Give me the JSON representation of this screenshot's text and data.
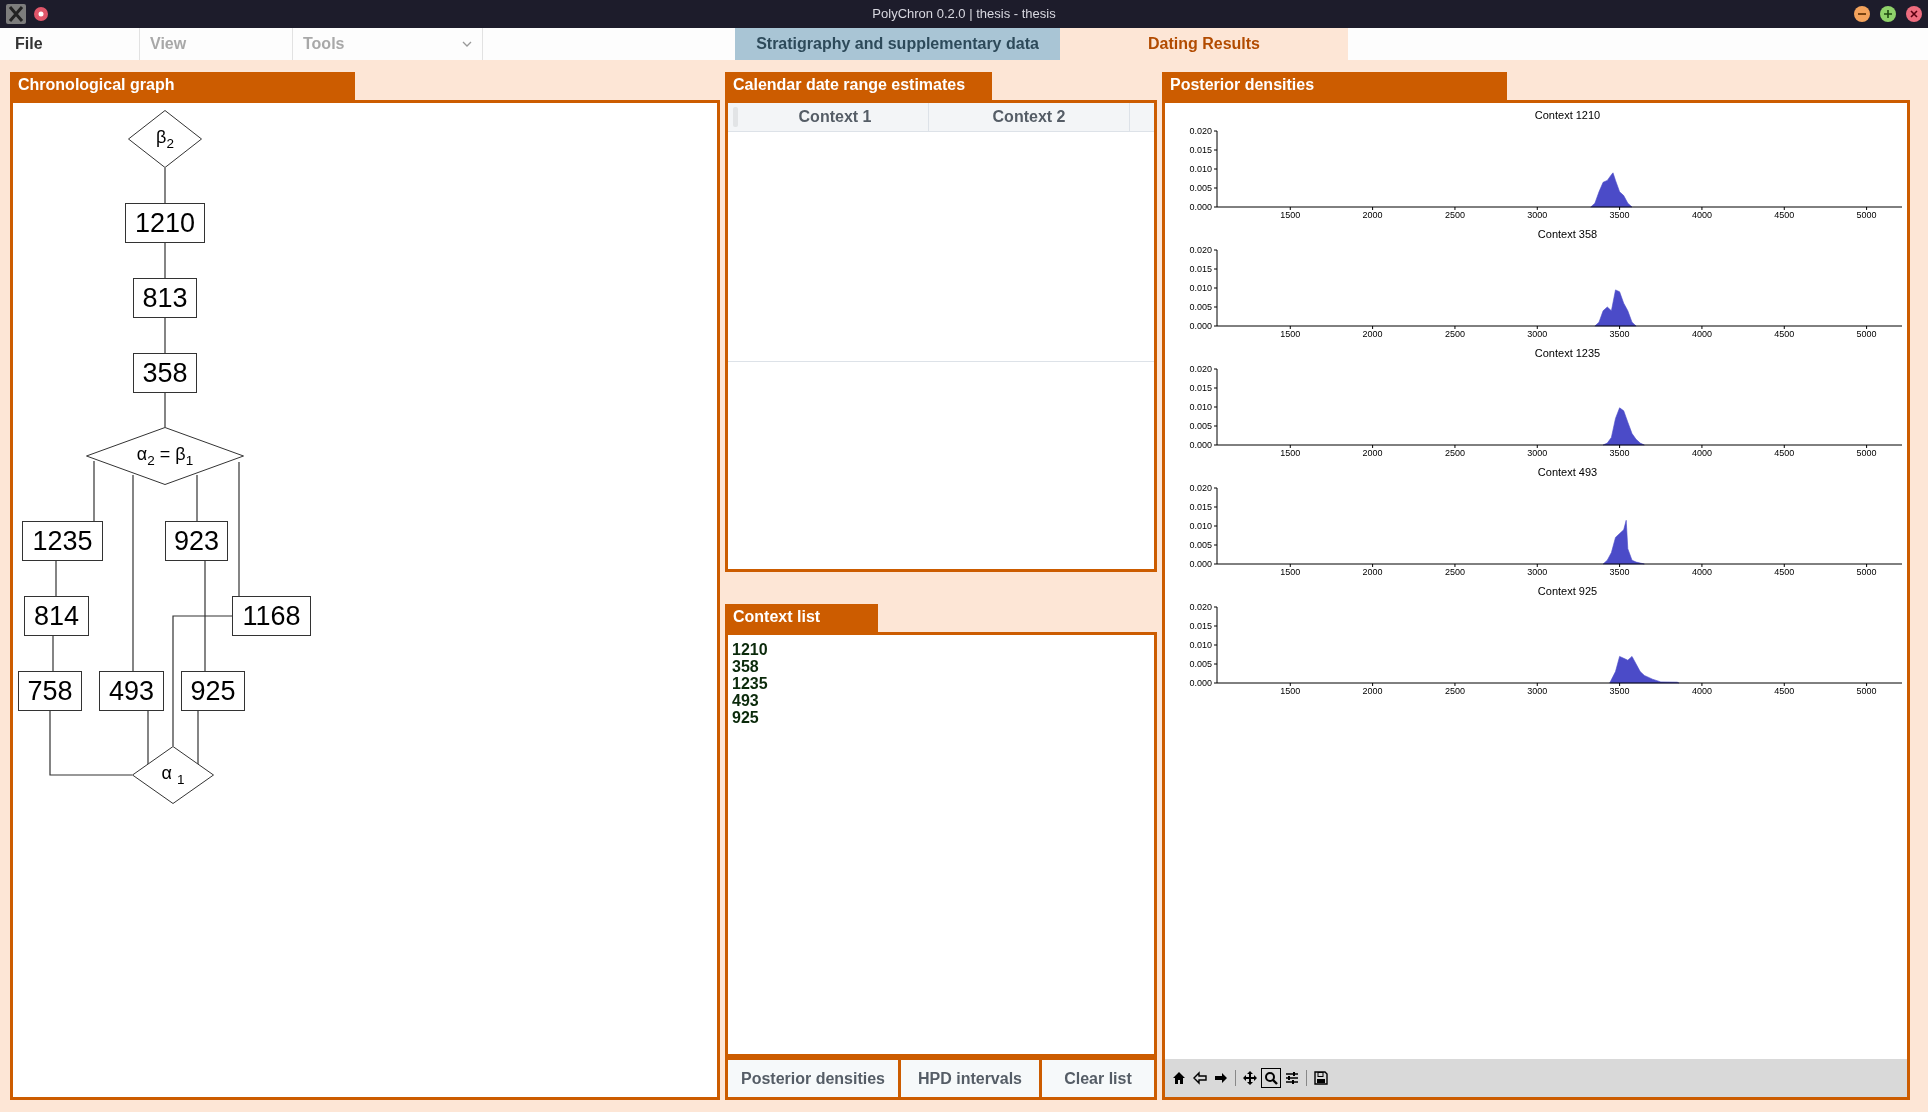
{
  "window": {
    "title": "PolyChron 0.2.0 | thesis - thesis"
  },
  "menu": [
    {
      "label": "File",
      "kind": "menu",
      "disabled": false
    },
    {
      "label": "View",
      "kind": "menu",
      "disabled": true
    },
    {
      "label": "Tools",
      "kind": "dropdown",
      "disabled": true
    }
  ],
  "tabs": [
    {
      "label": "Stratigraphy and supplementary data",
      "selected": false
    },
    {
      "label": "Dating Results",
      "selected": true
    }
  ],
  "graph_panel": {
    "title": "Chronological graph",
    "nodes": [
      {
        "label": "β$_{2}$",
        "kind": "diamond"
      },
      {
        "label": "1210",
        "kind": "box"
      },
      {
        "label": "813",
        "kind": "box"
      },
      {
        "label": "358",
        "kind": "box"
      },
      {
        "label": "α$_{2}$ = β$_{1}$",
        "kind": "diamond"
      },
      {
        "label": "1235",
        "kind": "box"
      },
      {
        "label": "923",
        "kind": "box"
      },
      {
        "label": "814",
        "kind": "box"
      },
      {
        "label": "1168",
        "kind": "box"
      },
      {
        "label": "758",
        "kind": "box"
      },
      {
        "label": "493",
        "kind": "box"
      },
      {
        "label": "925",
        "kind": "box"
      },
      {
        "label": "α $_{1}$",
        "kind": "diamond"
      }
    ]
  },
  "estimates_panel": {
    "title": "Calendar date range estimates",
    "columns": [
      "Context 1",
      "Context 2"
    ]
  },
  "context_list": {
    "title": "Context list",
    "items": [
      "1210",
      "358",
      "1235",
      "493",
      "925"
    ]
  },
  "buttons": [
    "Posterior densities",
    "HPD intervals",
    "Clear list"
  ],
  "densities_panel": {
    "title": "Posterior densities",
    "charts": [
      {
        "chart_data": {
          "type": "area",
          "title": "Context 1210",
          "x": [
            3325,
            3350,
            3375,
            3400,
            3425,
            3450,
            3460,
            3475,
            3500,
            3525,
            3550,
            3575
          ],
          "values": [
            0,
            0.001,
            0.004,
            0.0065,
            0.007,
            0.0085,
            0.009,
            0.007,
            0.004,
            0.003,
            0.001,
            0
          ],
          "xlim": [
            1055,
            5215
          ],
          "ylim": [
            0,
            0.02
          ],
          "xticks": [
            1500,
            2000,
            2500,
            3000,
            3500,
            4000,
            4500,
            5000
          ],
          "yticks": [
            {
              "value": 0,
              "label": "0.000"
            },
            {
              "value": 0.005,
              "label": "0.005"
            },
            {
              "value": 0.01,
              "label": "0.010"
            },
            {
              "value": 0.015,
              "label": "0.015"
            },
            {
              "value": 0.02,
              "label": "0.020"
            }
          ]
        }
      },
      {
        "chart_data": {
          "type": "area",
          "title": "Context 358",
          "x": [
            3350,
            3375,
            3400,
            3425,
            3450,
            3475,
            3500,
            3525,
            3550,
            3575,
            3600
          ],
          "values": [
            0,
            0.001,
            0.004,
            0.005,
            0.004,
            0.0095,
            0.009,
            0.006,
            0.004,
            0.001,
            0
          ],
          "xlim": [
            1055,
            5215
          ],
          "ylim": [
            0,
            0.02
          ],
          "xticks": [
            1500,
            2000,
            2500,
            3000,
            3500,
            4000,
            4500,
            5000
          ],
          "yticks": [
            {
              "value": 0,
              "label": "0.000"
            },
            {
              "value": 0.005,
              "label": "0.005"
            },
            {
              "value": 0.01,
              "label": "0.010"
            },
            {
              "value": 0.015,
              "label": "0.015"
            },
            {
              "value": 0.02,
              "label": "0.020"
            }
          ]
        }
      },
      {
        "chart_data": {
          "type": "area",
          "title": "Context 1235",
          "x": [
            3400,
            3425,
            3450,
            3475,
            3500,
            3525,
            3550,
            3575,
            3600,
            3625,
            3650
          ],
          "values": [
            0,
            0.0005,
            0.002,
            0.007,
            0.0098,
            0.009,
            0.006,
            0.003,
            0.0015,
            0.0005,
            0
          ],
          "xlim": [
            1055,
            5215
          ],
          "ylim": [
            0,
            0.02
          ],
          "xticks": [
            1500,
            2000,
            2500,
            3000,
            3500,
            4000,
            4500,
            5000
          ],
          "yticks": [
            {
              "value": 0,
              "label": "0.000"
            },
            {
              "value": 0.005,
              "label": "0.005"
            },
            {
              "value": 0.01,
              "label": "0.010"
            },
            {
              "value": 0.015,
              "label": "0.015"
            },
            {
              "value": 0.02,
              "label": "0.020"
            }
          ]
        }
      },
      {
        "chart_data": {
          "type": "area",
          "title": "Context 493",
          "x": [
            3400,
            3425,
            3450,
            3475,
            3500,
            3525,
            3540,
            3550,
            3575,
            3600,
            3650
          ],
          "values": [
            0,
            0.001,
            0.003,
            0.007,
            0.008,
            0.009,
            0.0115,
            0.004,
            0.001,
            0.0005,
            0
          ],
          "xlim": [
            1055,
            5215
          ],
          "ylim": [
            0,
            0.02
          ],
          "xticks": [
            1500,
            2000,
            2500,
            3000,
            3500,
            4000,
            4500,
            5000
          ],
          "yticks": [
            {
              "value": 0,
              "label": "0.000"
            },
            {
              "value": 0.005,
              "label": "0.005"
            },
            {
              "value": 0.01,
              "label": "0.010"
            },
            {
              "value": 0.015,
              "label": "0.015"
            },
            {
              "value": 0.02,
              "label": "0.020"
            }
          ]
        }
      },
      {
        "chart_data": {
          "type": "area",
          "title": "Context 925",
          "x": [
            3440,
            3475,
            3500,
            3525,
            3550,
            3575,
            3600,
            3625,
            3650,
            3700,
            3750,
            3850,
            3860
          ],
          "values": [
            0,
            0.003,
            0.007,
            0.0065,
            0.006,
            0.007,
            0.005,
            0.003,
            0.002,
            0.001,
            0.0003,
            0.0002,
            0
          ],
          "xlim": [
            1055,
            5215
          ],
          "ylim": [
            0,
            0.02
          ],
          "xticks": [
            1500,
            2000,
            2500,
            3000,
            3500,
            4000,
            4500,
            5000
          ],
          "yticks": [
            {
              "value": 0,
              "label": "0.000"
            },
            {
              "value": 0.005,
              "label": "0.005"
            },
            {
              "value": 0.01,
              "label": "0.010"
            },
            {
              "value": 0.015,
              "label": "0.015"
            },
            {
              "value": 0.02,
              "label": "0.020"
            }
          ]
        }
      }
    ],
    "toolbar": [
      {
        "kind": "home",
        "selected": false
      },
      {
        "kind": "back",
        "selected": false
      },
      {
        "kind": "forward",
        "selected": false
      },
      {
        "kind": "move",
        "selected": false
      },
      {
        "kind": "zoom",
        "selected": true
      },
      {
        "kind": "sliders",
        "selected": false
      },
      {
        "kind": "save",
        "selected": false
      }
    ]
  }
}
